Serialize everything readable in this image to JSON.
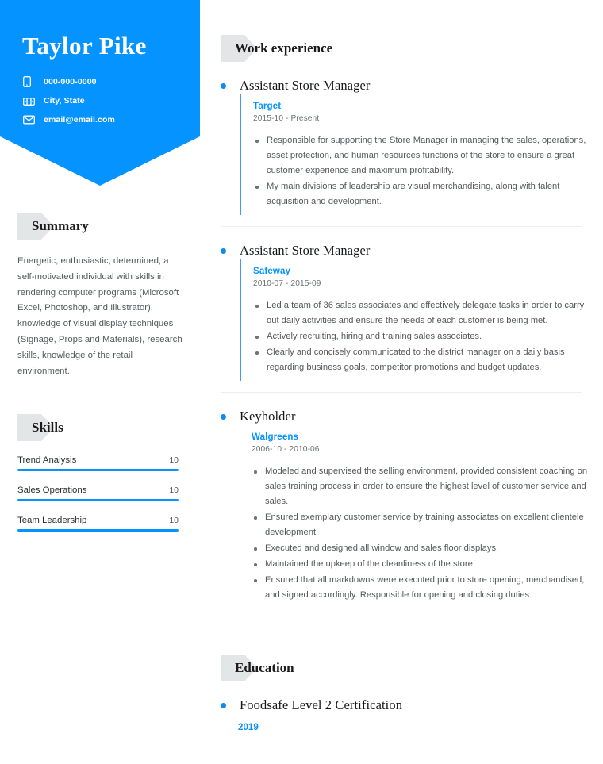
{
  "theme": {
    "accent_blue": "#0593ff",
    "tag_gray": "#e3e6e6",
    "body_text": "#55595c"
  },
  "header": {
    "name": "Taylor Pike",
    "contacts": [
      {
        "icon": "phone-icon",
        "text": "000-000-0000"
      },
      {
        "icon": "location-icon",
        "text": "City, State"
      },
      {
        "icon": "email-icon",
        "text": "email@email.com"
      }
    ]
  },
  "sidebar": {
    "summary": {
      "heading": "Summary",
      "text": "Energetic, enthusiastic, determined, a self-motivated individual with skills in rendering computer programs (Microsoft Excel, Photoshop, and Illustrator), knowledge of visual display techniques (Signage, Props and Materials), research skills, knowledge of the retail environment."
    },
    "skills": {
      "heading": "Skills",
      "items": [
        {
          "name": "Trend Analysis",
          "score": "10",
          "percent": 100
        },
        {
          "name": "Sales Operations",
          "score": "10",
          "percent": 100
        },
        {
          "name": "Team Leadership",
          "score": "10",
          "percent": 100
        }
      ]
    }
  },
  "main": {
    "work": {
      "heading": "Work experience",
      "entries": [
        {
          "title": "Assistant Store Manager",
          "company": "Target",
          "date": "2015-10 - Present",
          "railed": true,
          "points": [
            "Responsible for supporting the Store Manager in managing the sales, operations, asset protection, and human resources functions of the store to ensure a great customer experience and maximum profitability.",
            "My main divisions of leadership are visual merchandising, along with talent acquisition and development."
          ]
        },
        {
          "title": "Assistant Store Manager",
          "company": "Safeway",
          "date": "2010-07 - 2015-09",
          "railed": true,
          "points": [
            "Led a team of 36 sales associates and effectively delegate tasks in order to carry out daily activities and ensure the needs of each customer is being met.",
            "Actively recruiting, hiring and training sales associates.",
            "Clearly and concisely communicated to the district manager on a daily basis regarding business goals, competitor promotions and budget updates."
          ]
        },
        {
          "title": "Keyholder",
          "company": "Walgreens",
          "date": "2006-10 - 2010-06",
          "railed": false,
          "points": [
            "Modeled and supervised the selling environment, provided consistent coaching on sales training process in order to ensure the highest level of customer service and sales.",
            "Ensured exemplary customer service by training associates on excellent clientele development.",
            "Executed and designed all window and sales floor displays.",
            "Maintained the upkeep of the cleanliness of the store.",
            "Ensured that all markdowns were executed prior to store opening, merchandised, and signed accordingly. Responsible for opening and closing duties."
          ]
        }
      ]
    },
    "education": {
      "heading": "Education",
      "entries": [
        {
          "title": "Foodsafe Level 2 Certification",
          "year": "2019"
        }
      ]
    }
  }
}
